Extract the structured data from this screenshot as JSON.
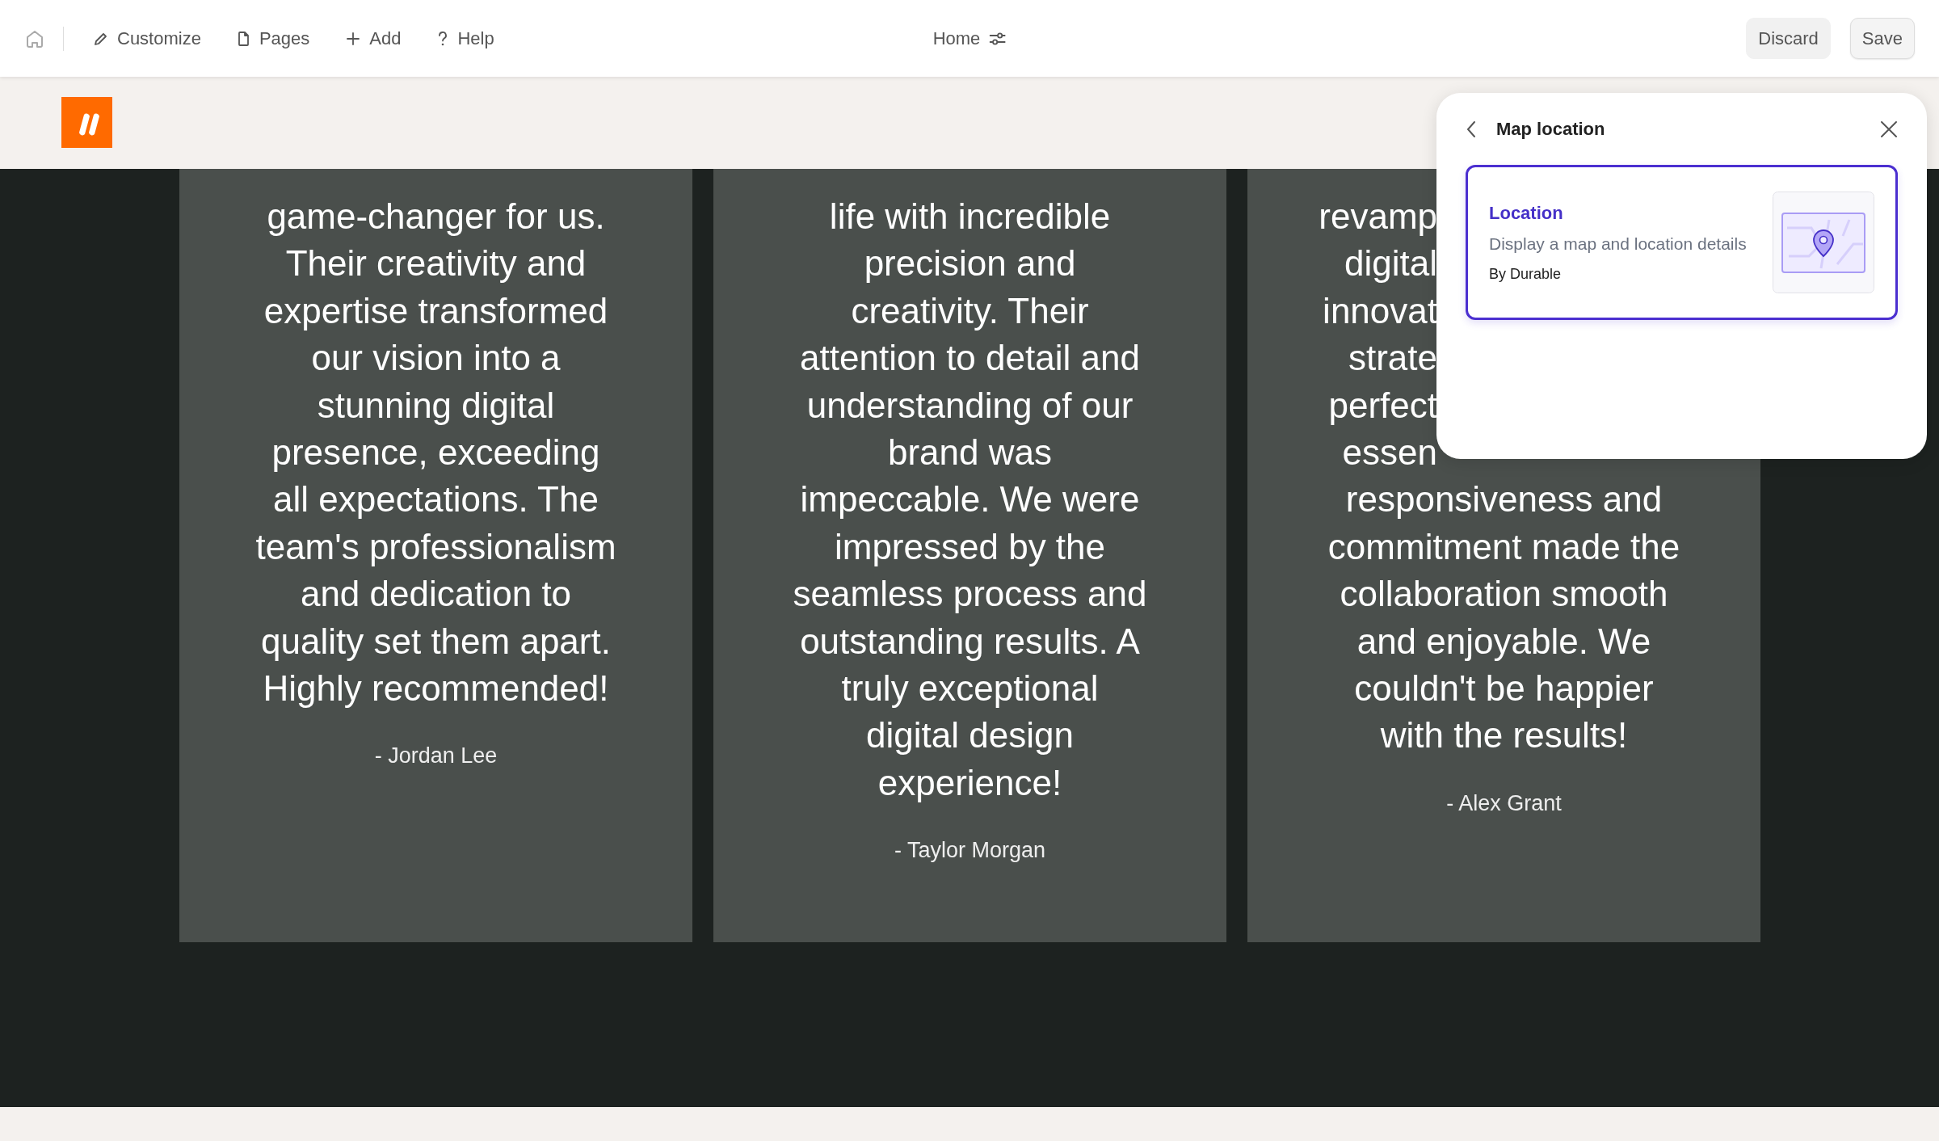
{
  "toolbar": {
    "items": [
      {
        "label": "Customize"
      },
      {
        "label": "Pages"
      },
      {
        "label": "Add"
      },
      {
        "label": "Help"
      }
    ],
    "page_selector": {
      "label": "Home"
    },
    "buttons": [
      {
        "label": "Discard",
        "kind": "filled"
      },
      {
        "label": "Save",
        "kind": "outlined"
      }
    ]
  },
  "testimonials": [
    {
      "lines": [
        "game-changer for us.",
        "Their creativity and",
        "expertise transformed",
        "our vision into a",
        "stunning digital",
        "presence, exceeding",
        "all expectations. The",
        "team's professionalism",
        "and dedication to",
        "quality set them apart.",
        "Highly recommended!"
      ],
      "author": "- Jordan Lee"
    },
    {
      "lines": [
        "life with incredible",
        "precision and",
        "creativity. Their",
        "attention to detail and",
        "understanding of our",
        "brand was",
        "impeccable. We were",
        "impressed by the",
        "seamless process and",
        "outstanding results. A",
        "truly exceptional",
        "digital design",
        "experience!"
      ],
      "author": "- Taylor Morgan"
    },
    {
      "clipped_lines": [
        "revamp",
        "digital",
        "innovat",
        "strate",
        "perfect",
        "essen"
      ],
      "lines": [
        "responsiveness and",
        "commitment made the",
        "collaboration smooth",
        "and enjoyable. We",
        "couldn't be happier",
        "with the results!"
      ],
      "author": "- Alex Grant"
    }
  ],
  "panel": {
    "title": "Map location",
    "options": [
      {
        "title": "Location",
        "description": "Display a map and location details",
        "byline": "By Durable",
        "selected": true
      }
    ]
  }
}
